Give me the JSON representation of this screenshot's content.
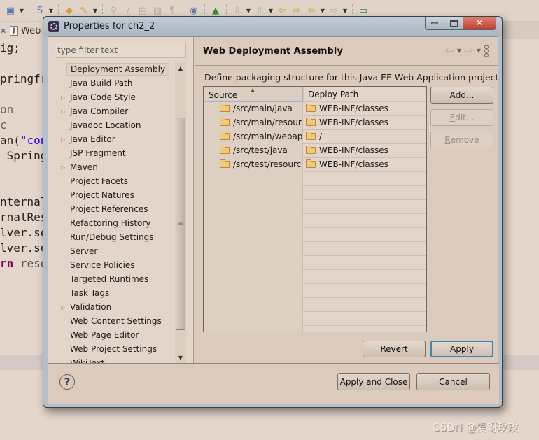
{
  "ide": {
    "editor_tab": {
      "label": "Web",
      "close": "✕"
    },
    "code_lines": [
      {
        "text": "ig;",
        "kind": "plain"
      },
      {
        "text": "",
        "kind": "plain"
      },
      {
        "text": "pringfr",
        "kind": "plain"
      },
      {
        "text": "",
        "kind": "plain"
      },
      {
        "text": "on",
        "kind": "ann"
      },
      {
        "text": "c",
        "kind": "ann"
      },
      {
        "text_pre": "an(",
        "text_str": "\"con",
        "kind": "mixed"
      },
      {
        "text": " Spring",
        "kind": "plain"
      },
      {
        "text": "",
        "kind": "plain"
      },
      {
        "text": "",
        "kind": "plain"
      },
      {
        "text": "nternal",
        "kind": "plain"
      },
      {
        "text": "rnalRes",
        "kind": "plain"
      },
      {
        "text": "lver.se",
        "kind": "plain"
      },
      {
        "text": "lver.se",
        "kind": "plain"
      },
      {
        "text_kw": "rn",
        "text_rest": " reso",
        "kind": "kwmixed"
      }
    ]
  },
  "dialog": {
    "title": "Properties for ch2_2",
    "window_buttons": {
      "minimize": "minimize",
      "maximize": "maximize",
      "close": "✕"
    },
    "filter": {
      "placeholder": "type filter text",
      "value": ""
    },
    "tree": [
      {
        "label": "Deployment Assembly",
        "expandable": false,
        "selected": true
      },
      {
        "label": "Java Build Path",
        "expandable": false
      },
      {
        "label": "Java Code Style",
        "expandable": true
      },
      {
        "label": "Java Compiler",
        "expandable": true
      },
      {
        "label": "Javadoc Location",
        "expandable": false
      },
      {
        "label": "Java Editor",
        "expandable": true
      },
      {
        "label": "JSP Fragment",
        "expandable": false
      },
      {
        "label": "Maven",
        "expandable": true
      },
      {
        "label": "Project Facets",
        "expandable": false
      },
      {
        "label": "Project Natures",
        "expandable": false
      },
      {
        "label": "Project References",
        "expandable": false
      },
      {
        "label": "Refactoring History",
        "expandable": false
      },
      {
        "label": "Run/Debug Settings",
        "expandable": false
      },
      {
        "label": "Server",
        "expandable": false
      },
      {
        "label": "Service Policies",
        "expandable": false
      },
      {
        "label": "Targeted Runtimes",
        "expandable": false
      },
      {
        "label": "Task Tags",
        "expandable": false
      },
      {
        "label": "Validation",
        "expandable": true
      },
      {
        "label": "Web Content Settings",
        "expandable": false
      },
      {
        "label": "Web Page Editor",
        "expandable": false
      },
      {
        "label": "Web Project Settings",
        "expandable": false
      },
      {
        "label": "WikiText",
        "expandable": false
      }
    ],
    "page": {
      "title": "Web Deployment Assembly",
      "description": "Define packaging structure for this Java EE Web Application project.",
      "table": {
        "columns": [
          "Source",
          "Deploy Path"
        ],
        "rows": [
          {
            "source": "/src/main/java",
            "deploy": "WEB-INF/classes"
          },
          {
            "source": "/src/main/resources",
            "deploy": "WEB-INF/classes"
          },
          {
            "source": "/src/main/webapp",
            "deploy": "/"
          },
          {
            "source": "/src/test/java",
            "deploy": "WEB-INF/classes"
          },
          {
            "source": "/src/test/resources",
            "deploy": "WEB-INF/classes"
          }
        ],
        "empty_rows": 12
      },
      "buttons": {
        "add": {
          "pre": "A",
          "mn": "d",
          "post": "d..."
        },
        "edit": {
          "pre": "",
          "mn": "E",
          "post": "dit..."
        },
        "remove": {
          "pre": "",
          "mn": "R",
          "post": "emove"
        },
        "revert": {
          "pre": "Re",
          "mn": "v",
          "post": "ert"
        },
        "apply": {
          "pre": "",
          "mn": "A",
          "post": "pply"
        }
      }
    },
    "footer": {
      "help": "?",
      "apply_and_close": "Apply and Close",
      "cancel": "Cancel"
    }
  },
  "watermark": "CSDN @爱呀玫玫"
}
